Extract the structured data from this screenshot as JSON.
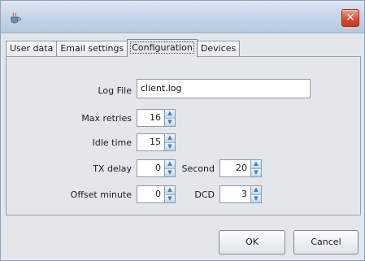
{
  "window": {
    "title": "",
    "close_glyph": "✕",
    "icon": "java-cup-icon"
  },
  "tabs": [
    {
      "label": "User data",
      "active": false
    },
    {
      "label": "Email settings",
      "active": false
    },
    {
      "label": "Configuration",
      "active": true
    },
    {
      "label": "Devices",
      "active": false
    }
  ],
  "form": {
    "log_file": {
      "label": "Log File",
      "value": "client.log"
    },
    "max_retries": {
      "label": "Max retries",
      "value": "16"
    },
    "idle_time": {
      "label": "Idle time",
      "value": "15"
    },
    "tx_delay": {
      "label": "TX delay",
      "value": "0"
    },
    "second": {
      "label": "Second",
      "value": "20"
    },
    "offset_minute": {
      "label": "Offset minute",
      "value": "0"
    },
    "dcd": {
      "label": "DCD",
      "value": "3"
    }
  },
  "buttons": {
    "ok": "OK",
    "cancel": "Cancel"
  },
  "colors": {
    "close_button": "#d9482a",
    "spinner_arrow": "#3f79b4",
    "titlebar": "#c7d6e8"
  }
}
